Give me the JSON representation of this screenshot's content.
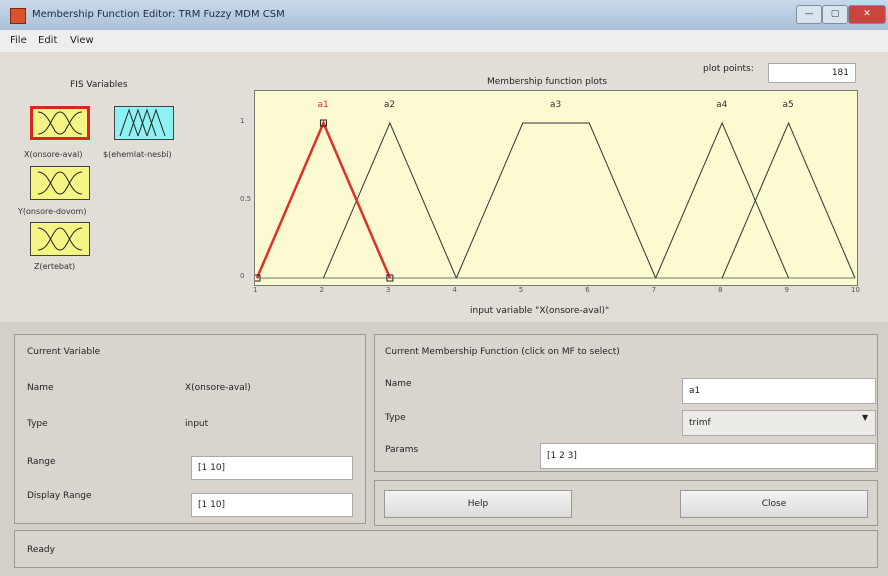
{
  "window": {
    "title": "Membership Function Editor: TRM Fuzzy MDM CSM",
    "min": "—",
    "max": "▢",
    "close": "✕"
  },
  "menu": [
    "File",
    "Edit",
    "View"
  ],
  "fis": {
    "title": "FIS Variables",
    "inputs": [
      {
        "label": "X(onsore-aval)",
        "selected": true,
        "color": "#f5f586"
      },
      {
        "label": "$(ehemlat-nesbi)",
        "selected": false,
        "color": "#8ef2f2"
      },
      {
        "label": "Y(onsore-dovom)",
        "selected": false,
        "color": "#f5f586"
      },
      {
        "label": "Z(ertebat)",
        "selected": false,
        "color": "#f5f586"
      }
    ]
  },
  "plot": {
    "title": "Membership function plots",
    "plot_points_label": "plot points:",
    "plot_points": "181",
    "x_axis_label": "input variable \"X(onsore-aval)\"",
    "x_ticks": [
      "1",
      "2",
      "3",
      "4",
      "5",
      "6",
      "7",
      "8",
      "9",
      "10"
    ],
    "y_ticks": [
      "1",
      "0.5",
      "0"
    ],
    "mfs": [
      {
        "name": "a1",
        "params": [
          1,
          2,
          3
        ],
        "selected": true
      },
      {
        "name": "a2",
        "params": [
          2,
          3,
          4
        ],
        "selected": false
      },
      {
        "name": "a3",
        "params": [
          4,
          5,
          6,
          7
        ],
        "selected": false
      },
      {
        "name": "a4",
        "params": [
          7,
          8,
          9
        ],
        "selected": false
      },
      {
        "name": "a5",
        "params": [
          8,
          9,
          10
        ],
        "selected": false
      }
    ],
    "selected_color": "#e0302a",
    "line_color": "#333333"
  },
  "current_variable": {
    "title": "Current Variable",
    "name_label": "Name",
    "name_value": "X(onsore-aval)",
    "type_label": "Type",
    "type_value": "input",
    "range_label": "Range",
    "range_value": "[1 10]",
    "display_range_label": "Display Range",
    "display_range_value": "[1 10]"
  },
  "current_mf": {
    "title": "Current Membership Function (click on MF to select)",
    "name_label": "Name",
    "name_value": "a1",
    "type_label": "Type",
    "type_value": "trimf",
    "params_label": "Params",
    "params_value": "[1 2 3]"
  },
  "buttons": {
    "help": "Help",
    "close": "Close"
  },
  "status": "Ready"
}
